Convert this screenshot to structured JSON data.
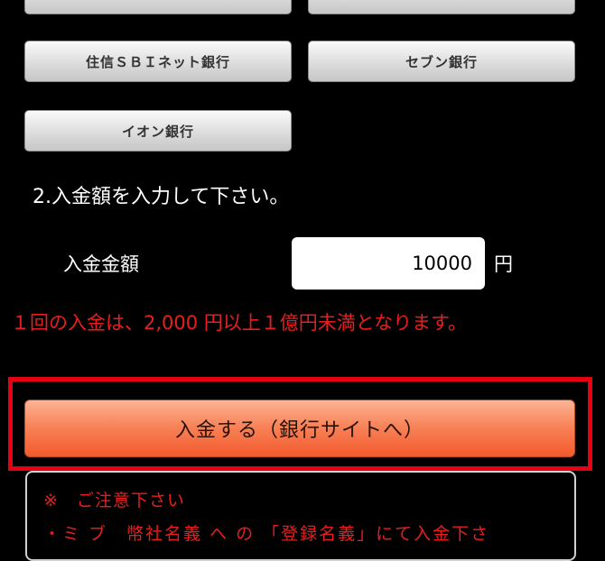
{
  "banks": {
    "top_row": [
      "",
      ""
    ],
    "sbi": "住信ＳＢＩネット銀行",
    "seven": "セブン銀行",
    "aeon": "イオン銀行"
  },
  "step2_title": "2.入金額を入力して下さい。",
  "amount": {
    "label": "入金金額",
    "value": "10000",
    "unit": "円"
  },
  "notice": "１回の入金は、2,000 円以上１億円未満となります。",
  "submit_label": "入金する（銀行サイトへ）",
  "caution": {
    "title": "※　ご注意下さい",
    "line1": "・ミ ブ　幣社名義 へ の 「登録名義」にて入金下さ"
  },
  "colors": {
    "background": "#000000",
    "warning_text": "#e81e1e",
    "highlight_border": "#e60012",
    "submit_button": "#f56a3c"
  }
}
